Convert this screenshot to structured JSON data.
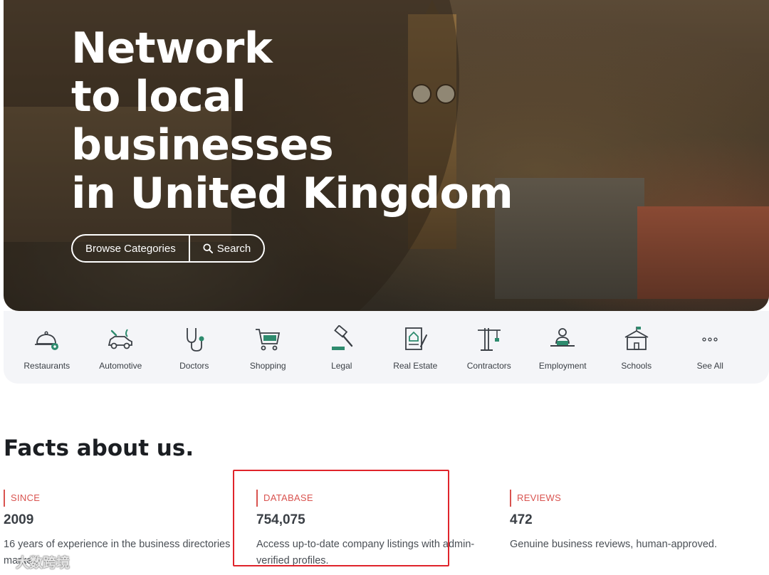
{
  "hero": {
    "title_lines": [
      "Network",
      "to local",
      "businesses",
      "in United Kingdom"
    ],
    "browse_label": "Browse Categories",
    "search_label": "Search"
  },
  "categories": [
    {
      "label": "Restaurants",
      "icon": "restaurant-cloche-icon"
    },
    {
      "label": "Automotive",
      "icon": "car-repair-icon"
    },
    {
      "label": "Doctors",
      "icon": "stethoscope-icon"
    },
    {
      "label": "Shopping",
      "icon": "shopping-cart-icon"
    },
    {
      "label": "Legal",
      "icon": "gavel-icon"
    },
    {
      "label": "Real Estate",
      "icon": "house-contract-icon"
    },
    {
      "label": "Contractors",
      "icon": "crane-icon"
    },
    {
      "label": "Employment",
      "icon": "worker-desk-icon"
    },
    {
      "label": "Schools",
      "icon": "school-building-icon"
    },
    {
      "label": "See All",
      "icon": "more-dots-icon"
    }
  ],
  "facts": {
    "title": "Facts about us.",
    "items": [
      {
        "tag": "SINCE",
        "value": "2009",
        "desc": "16 years of experience in the business directories market."
      },
      {
        "tag": "DATABASE",
        "value": "754,075",
        "desc": "Access up-to-date company listings with admin-verified profiles."
      },
      {
        "tag": "REVIEWS",
        "value": "472",
        "desc": "Genuine business reviews, human-approved."
      }
    ]
  },
  "watermark": "大数跨境",
  "colors": {
    "accent_red": "#d9534f",
    "highlight_red": "#e0242b",
    "icon_green": "#2e8b6e",
    "icon_dark": "#3a3f45"
  }
}
